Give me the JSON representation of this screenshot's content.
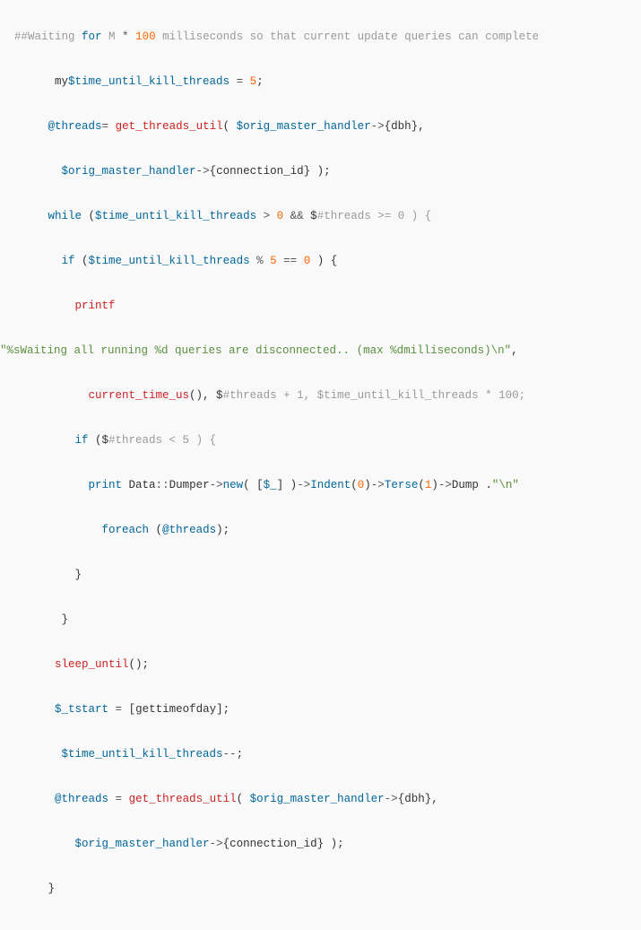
{
  "code": {
    "l1": {
      "a": "##Waiting ",
      "b": "for",
      "c": " M ",
      "d": "*",
      "e": " ",
      "f": "100",
      "g": " milliseconds so that current update queries can complete"
    },
    "l2": {
      "a": "      my",
      "b": "$time_until_kill_threads",
      "c": " ",
      "d": "=",
      "e": " ",
      "f": "5",
      "g": ";"
    },
    "l3": {
      "a": "     ",
      "b": "@threads",
      "c": "=",
      "d": " ",
      "e": "get_threads_util",
      "f": "( ",
      "g": "$orig_master_handler",
      "h": "-",
      "i": ">",
      "j": "{dbh},"
    },
    "l4": {
      "a": "       ",
      "b": "$orig_master_handler",
      "c": "-",
      "d": ">",
      "e": "{connection_id} );"
    },
    "l5": {
      "a": "     ",
      "b": "while",
      "c": " (",
      "d": "$time_until_kill_threads",
      "e": " ",
      "f": ">",
      "g": " ",
      "h": "0",
      "i": " ",
      "j": "&&",
      "k": " $",
      "l": "#threads >= 0 ) {"
    },
    "l6": {
      "a": "       ",
      "b": "if",
      "c": " (",
      "d": "$time_until_kill_threads",
      "e": " ",
      "f": "%",
      "g": " ",
      "h": "5",
      "i": " ",
      "j": "==",
      "k": " ",
      "l": "0",
      "m": " ) {"
    },
    "l7": {
      "a": "         ",
      "b": "printf"
    },
    "l8": {
      "a": "\"%sWaiting all running %d queries are disconnected.. (max %dmilliseconds)\\n\"",
      "b": ","
    },
    "l9": {
      "a": "           ",
      "b": "current_time_us",
      "c": "(), $",
      "d": "#threads + 1, $time_until_kill_threads * 100;"
    },
    "l10": {
      "a": "         ",
      "b": "if",
      "c": " ($",
      "d": "#threads < 5 ) {"
    },
    "l11": {
      "a": "           ",
      "b": "print",
      "c": " Data",
      "d": ":",
      "e": ":",
      "f": "Dumper",
      "g": "-",
      "h": ">",
      "i": "new",
      "j": "( [",
      "k": "$_",
      "l": "] )",
      "m": "-",
      "n": ">",
      "o": "Indent",
      "p": "(",
      "q": "0",
      "r": ")",
      "s": "-",
      "t": ">",
      "u": "Terse",
      "v": "(",
      "w": "1",
      "x": ")",
      "y": "-",
      "z": ">",
      "aa": "Dump .",
      "bb": "\"\\n\""
    },
    "l12": {
      "a": "             ",
      "b": "foreach",
      "c": " (",
      "d": "@threads",
      "e": ");"
    },
    "l13": {
      "a": "         }"
    },
    "l14": {
      "a": "       }"
    },
    "l15": {
      "a": "      ",
      "b": "sleep_until",
      "c": "();"
    },
    "l16": {
      "a": "      ",
      "b": "$_tstart",
      "c": " ",
      "d": "=",
      "e": " [gettimeofday];"
    },
    "l17": {
      "a": "       ",
      "b": "$time_until_kill_threads",
      "c": "--",
      "d": ";"
    },
    "l18": {
      "a": "      ",
      "b": "@threads",
      "c": " ",
      "d": "=",
      "e": " ",
      "f": "get_threads_util",
      "g": "( ",
      "h": "$orig_master_handler",
      "i": "-",
      "j": ">",
      "k": "{dbh},"
    },
    "l19": {
      "a": "         ",
      "b": "$orig_master_handler",
      "c": "-",
      "d": ">",
      "e": "{connection_id} );"
    },
    "l20": {
      "a": "     }"
    }
  }
}
